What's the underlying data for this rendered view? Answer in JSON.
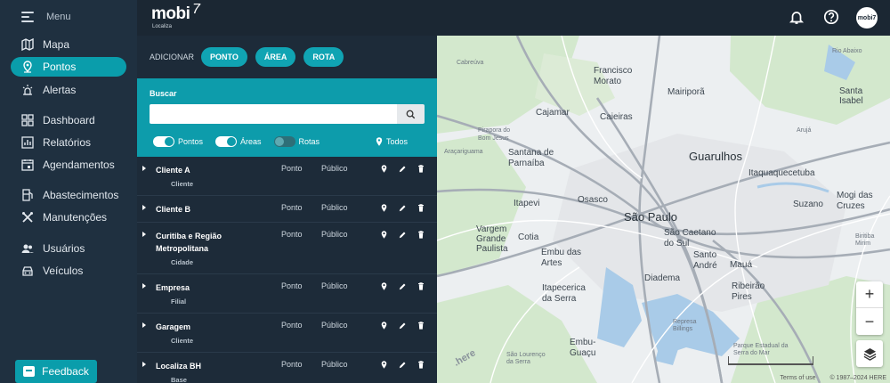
{
  "sidebar": {
    "menu_label": "Menu",
    "items": [
      {
        "label": "Mapa",
        "icon": "map-icon"
      },
      {
        "label": "Pontos",
        "icon": "pin-icon",
        "active": true
      },
      {
        "label": "Alertas",
        "icon": "alert-icon"
      },
      {
        "label": "Dashboard",
        "icon": "dashboard-icon"
      },
      {
        "label": "Relatórios",
        "icon": "report-icon"
      },
      {
        "label": "Agendamentos",
        "icon": "calendar-icon"
      },
      {
        "label": "Abastecimentos",
        "icon": "fuel-icon"
      },
      {
        "label": "Manutenções",
        "icon": "tools-icon"
      },
      {
        "label": "Usuários",
        "icon": "users-icon"
      },
      {
        "label": "Veículos",
        "icon": "car-icon"
      }
    ],
    "feedback_label": "Feedback"
  },
  "topbar": {
    "logo_text": "mobi",
    "logo_number": "7",
    "logo_sub": "Localiza",
    "avatar_text": "mobi7"
  },
  "panel": {
    "add_label": "ADICIONAR",
    "add_buttons": [
      "PONTO",
      "ÁREA",
      "ROTA"
    ],
    "search_label": "Buscar",
    "search_value": "",
    "filters": [
      {
        "label": "Pontos",
        "on": true
      },
      {
        "label": "Áreas",
        "on": true
      },
      {
        "label": "Rotas",
        "on": false
      }
    ],
    "filter_all": "Todos",
    "rows": [
      {
        "name": "Cliente A",
        "type": "Ponto",
        "visibility": "Público",
        "tag": "Cliente"
      },
      {
        "name": "Cliente B",
        "type": "Ponto",
        "visibility": "Público",
        "tag": ""
      },
      {
        "name": "Curitiba e Região Metropolitana",
        "type": "Ponto",
        "visibility": "Público",
        "tag": "Cidade"
      },
      {
        "name": "Empresa",
        "type": "Ponto",
        "visibility": "Público",
        "tag": "Filial"
      },
      {
        "name": "Garagem",
        "type": "Ponto",
        "visibility": "Público",
        "tag": "Cliente"
      },
      {
        "name": "Localiza BH",
        "type": "Ponto",
        "visibility": "Público",
        "tag": "Base"
      }
    ]
  },
  "map": {
    "labels": [
      {
        "text": "Cabreúva",
        "size": "sm"
      },
      {
        "text": "Francisco Morato",
        "size": "md"
      },
      {
        "text": "Mairiporã",
        "size": "md"
      },
      {
        "text": "Cajamar",
        "size": "md"
      },
      {
        "text": "Caieiras",
        "size": "md"
      },
      {
        "text": "Pirapora do Bom Jesus",
        "size": "sm"
      },
      {
        "text": "Santana de Parnaíba",
        "size": "md"
      },
      {
        "text": "Araçariguama",
        "size": "sm"
      },
      {
        "text": "Guarulhos",
        "size": "big"
      },
      {
        "text": "Itaquaquecetuba",
        "size": "md"
      },
      {
        "text": "Santa Isabel",
        "size": "md"
      },
      {
        "text": "Arujá",
        "size": "sm"
      },
      {
        "text": "Itapevi",
        "size": "md"
      },
      {
        "text": "Osasco",
        "size": "md"
      },
      {
        "text": "São Paulo",
        "size": "big"
      },
      {
        "text": "Suzano",
        "size": "md"
      },
      {
        "text": "Mogi das Cruzes",
        "size": "md"
      },
      {
        "text": "Vargem Grande Paulista",
        "size": "md"
      },
      {
        "text": "Cotia",
        "size": "md"
      },
      {
        "text": "Embu das Artes",
        "size": "md"
      },
      {
        "text": "São Caetano do Sul",
        "size": "md"
      },
      {
        "text": "Santo André",
        "size": "md"
      },
      {
        "text": "Mauá",
        "size": "md"
      },
      {
        "text": "Diadema",
        "size": "md"
      },
      {
        "text": "Itapecerica da Serra",
        "size": "md"
      },
      {
        "text": "Ribeirão Pires",
        "size": "md"
      },
      {
        "text": "Embu-Guaçu",
        "size": "md"
      },
      {
        "text": "São Lourenço da Serra",
        "size": "sm"
      },
      {
        "text": "Biritiba Mirim",
        "size": "sm"
      },
      {
        "text": "Rio Abaixo",
        "size": "sm"
      },
      {
        "text": "Represa Billings",
        "size": "sm"
      },
      {
        "text": "Parque Estadual da Serra do Mar",
        "size": "sm"
      }
    ],
    "zoom_in": "+",
    "zoom_out": "−",
    "watermark": ".here",
    "scale_label": "",
    "attribution_terms": "Terms of use",
    "attribution_copy": "© 1987–2024 HERE",
    "colors": {
      "water": "#a9cbe8",
      "green": "#cfe6c8",
      "road": "#ffffff",
      "highway": "#a6adb6"
    }
  }
}
